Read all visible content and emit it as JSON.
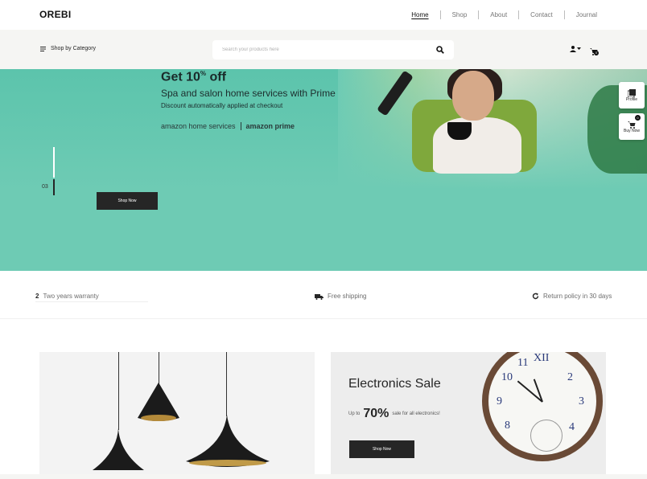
{
  "header": {
    "logo": "OREBI",
    "nav": [
      {
        "label": "Home",
        "active": true
      },
      {
        "label": "Shop",
        "active": false
      },
      {
        "label": "About",
        "active": false
      },
      {
        "label": "Contact",
        "active": false
      },
      {
        "label": "Journal",
        "active": false
      }
    ]
  },
  "searchbar": {
    "category_label": "Shop by Category",
    "search_placeholder": "Search your products here",
    "cart_count": "0"
  },
  "hero": {
    "title": "Get 10",
    "title_sup": "%",
    "title_end": " off",
    "subtitle": "Spa and salon home services with Prime",
    "note": "Discount automatically applied at checkout",
    "brand1": "amazon home services",
    "brand2": "amazon prime",
    "slide_number": "03",
    "button": "Shop Now"
  },
  "side_buttons": {
    "profile": "Profile",
    "buy_now": "Buy Now",
    "buy_count": "0"
  },
  "features": {
    "warranty_num": "2",
    "warranty": "Two years warranty",
    "shipping": "Free shipping",
    "returns": "Return policy in 30 days"
  },
  "promo": {
    "electronics_title": "Electronics Sale",
    "upto": "Up to",
    "percent": "70%",
    "sale_text": "sale for all electronics!",
    "button": "Shop Now"
  },
  "colors": {
    "hero_bg": "#6ecbb4",
    "dark": "#262626"
  }
}
